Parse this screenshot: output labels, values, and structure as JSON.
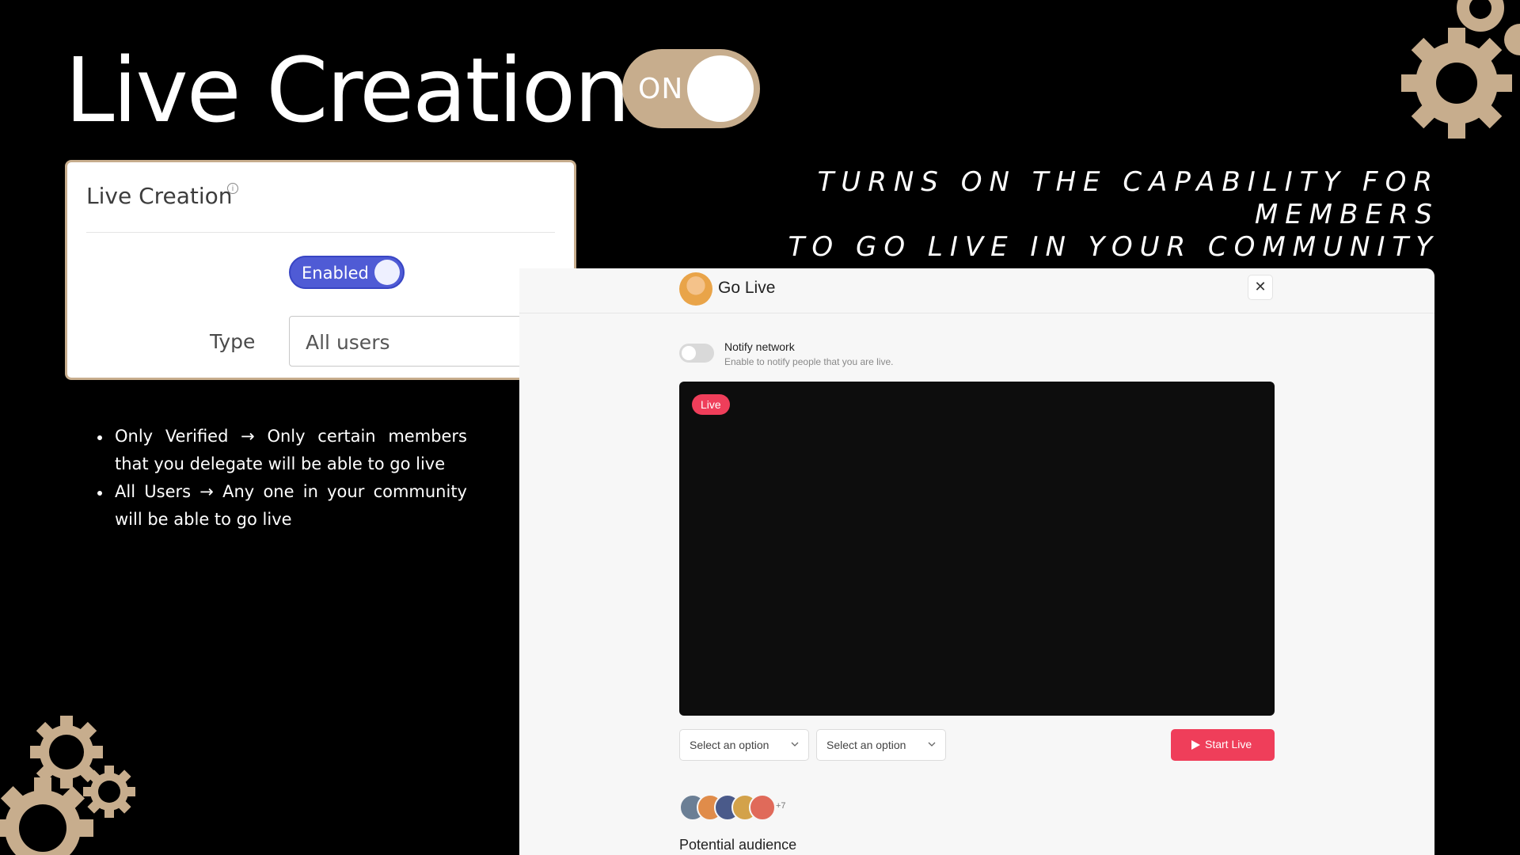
{
  "header": {
    "title": "Live Creation",
    "switch_label": "ON"
  },
  "settings_card": {
    "title": "Live Creation",
    "info_icon": "info-icon",
    "toggle_label": "Enabled",
    "type_label": "Type",
    "type_value": "All users"
  },
  "description": {
    "line1": "TURNS ON THE CAPABILITY FOR MEMBERS",
    "line2": "TO GO LIVE IN YOUR COMMUNITY"
  },
  "bullets": [
    "Only Verified → Only certain members that you delegate will be able to go live",
    "All Users → Any one in your community will be able to go live"
  ],
  "go_live": {
    "title": "Go Live",
    "close": "✕",
    "notify_title": "Notify network",
    "notify_subtitle": "Enable to notify people that you are live.",
    "live_badge": "Live",
    "select_1": "Select an option",
    "select_2": "Select an option",
    "start_button": "Start Live",
    "audience_more": "+7",
    "audience_label": "Potential audience"
  },
  "colors": {
    "accent_tan": "#c7ad8d",
    "enabled_blue": "#4f5bd5",
    "live_red": "#ef3e5a"
  }
}
